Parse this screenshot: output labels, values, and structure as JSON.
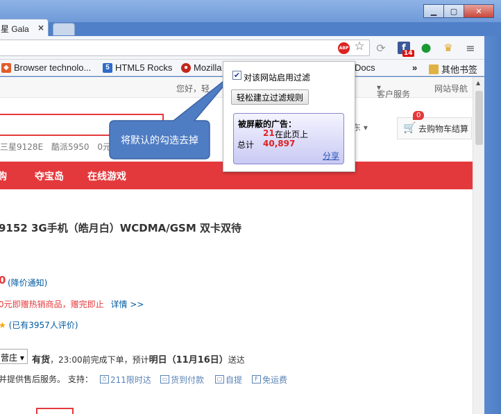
{
  "browser": {
    "tab_active_title": "星 Gala",
    "tab_close": "×",
    "window_minimize": "▁",
    "window_maximize": "▢",
    "window_close": "✕",
    "facebook_badge": "14"
  },
  "bookmarks": [
    {
      "label": "Browser technolo...",
      "icon": "browser-tech-icon"
    },
    {
      "label": "HTML5 Rocks",
      "icon": "html5-icon"
    },
    {
      "label": "Mozilla",
      "icon": "mozilla-icon"
    },
    {
      "label": "Docs",
      "icon": "docs-icon"
    }
  ],
  "bookmarks_more": "»",
  "bookmarks_other": "其他书签",
  "topnav": {
    "hello": "您好，轻",
    "jd": "东",
    "service": "客户服务",
    "sitenav": "网站导航",
    "sep": "|"
  },
  "search": {
    "city": "京东",
    "cart_label": "去购物车结算",
    "cart_count": "0",
    "hot_words": [
      "三星9128E",
      "酷派5950",
      "0元"
    ]
  },
  "rednav": [
    "购",
    "夺宝岛",
    "在线游戏"
  ],
  "product": {
    "title": "9152 3G手机（皓月白）WCDMA/GSM 双卡双待",
    "price_tail": "0",
    "price_notify": "(降价通知)",
    "promo": "0元即赠热销商品，赠完即止",
    "promo_detail": "详情 >>",
    "rating_count": "(已有3957人评价)",
    "region": "营庄",
    "stock": "有货",
    "delivery_prefix": "，23:00前完成下单，预计",
    "delivery_day": "明日（11月16日）",
    "delivery_suffix": "送达",
    "service_text": "并提供售后服务。   支持：",
    "service_chips": [
      "211限时达",
      "货到付款",
      "自提",
      "免运费"
    ]
  },
  "callout": {
    "text": "将默认的勾选去掉",
    "fill": "#4f7dc4"
  },
  "abp_popup": {
    "enable_label": "对该网站启用过滤",
    "enable_checked": true,
    "create_rule_button": "轻松建立过滤规则",
    "stats_title": "被屏蔽的广告：",
    "page_count": "21",
    "page_label": "在此页上",
    "total_label": "总计",
    "total_count": "40,897",
    "share_link": "分享"
  },
  "colors": {
    "jd_red": "#e4393c",
    "link_blue": "#005aa0",
    "count_red": "#e01f1f"
  }
}
